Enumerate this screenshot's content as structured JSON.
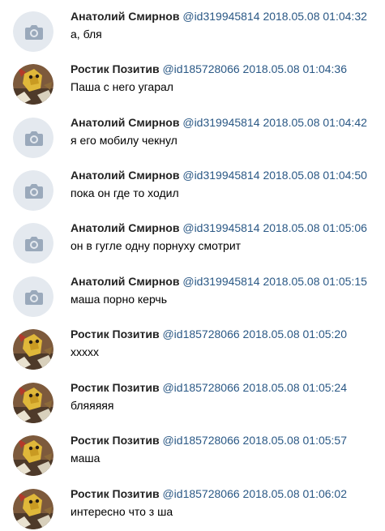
{
  "messages": [
    {
      "author": "Анатолий Смирнов",
      "handle": "@id319945814",
      "timestamp": "2018.05.08 01:04:32",
      "text": "а, бля",
      "avatar": "camera-placeholder-icon"
    },
    {
      "author": "Ростик Позитив",
      "handle": "@id185728066",
      "timestamp": "2018.05.08 01:04:36",
      "text": "Паша с него угарал",
      "avatar": "cartoon-avatar"
    },
    {
      "author": "Анатолий Смирнов",
      "handle": "@id319945814",
      "timestamp": "2018.05.08 01:04:42",
      "text": "я его мобилу чекнул",
      "avatar": "camera-placeholder-icon"
    },
    {
      "author": "Анатолий Смирнов",
      "handle": "@id319945814",
      "timestamp": "2018.05.08 01:04:50",
      "text": "пока он где то ходил",
      "avatar": "camera-placeholder-icon"
    },
    {
      "author": "Анатолий Смирнов",
      "handle": "@id319945814",
      "timestamp": "2018.05.08 01:05:06",
      "text": "он в гугле одну порнуху смотрит",
      "avatar": "camera-placeholder-icon"
    },
    {
      "author": "Анатолий Смирнов",
      "handle": "@id319945814",
      "timestamp": "2018.05.08 01:05:15",
      "text": "маша порно керчь",
      "avatar": "camera-placeholder-icon"
    },
    {
      "author": "Ростик Позитив",
      "handle": "@id185728066",
      "timestamp": "2018.05.08 01:05:20",
      "text": "xxxxx",
      "avatar": "cartoon-avatar"
    },
    {
      "author": "Ростик Позитив",
      "handle": "@id185728066",
      "timestamp": "2018.05.08 01:05:24",
      "text": "бляяяяя",
      "avatar": "cartoon-avatar"
    },
    {
      "author": "Ростик Позитив",
      "handle": "@id185728066",
      "timestamp": "2018.05.08 01:05:57",
      "text": "маша",
      "avatar": "cartoon-avatar"
    },
    {
      "author": "Ростик Позитив",
      "handle": "@id185728066",
      "timestamp": "2018.05.08 01:06:02",
      "text": "интересно что з ша",
      "avatar": "cartoon-avatar"
    }
  ],
  "colors": {
    "link": "#2a5885",
    "author": "#222222",
    "text": "#000000",
    "placeholder_bg": "#e4e9ef",
    "placeholder_icon": "#9aa9bb"
  }
}
